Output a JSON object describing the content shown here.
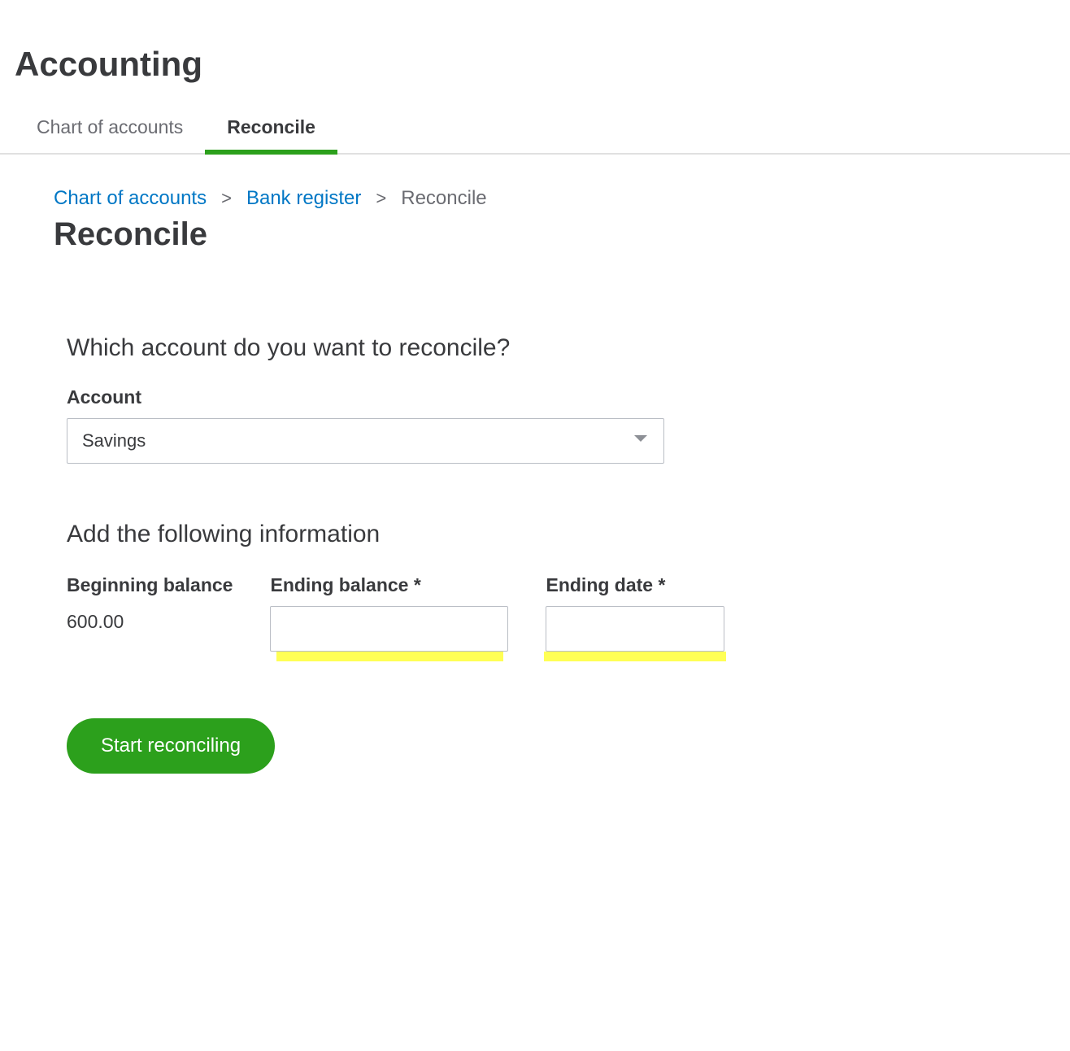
{
  "header": {
    "title": "Accounting"
  },
  "tabs": [
    {
      "label": "Chart of accounts",
      "active": false
    },
    {
      "label": "Reconcile",
      "active": true
    }
  ],
  "breadcrumb": {
    "items": [
      {
        "label": "Chart of accounts",
        "link": true
      },
      {
        "label": "Bank register",
        "link": true
      },
      {
        "label": "Reconcile",
        "link": false
      }
    ]
  },
  "page": {
    "subtitle": "Reconcile"
  },
  "form": {
    "prompt": "Which account do you want to reconcile?",
    "account": {
      "label": "Account",
      "value": "Savings"
    },
    "section_prompt": "Add the following information",
    "beginning_balance": {
      "label": "Beginning balance",
      "value": "600.00"
    },
    "ending_balance": {
      "label": "Ending balance *",
      "value": ""
    },
    "ending_date": {
      "label": "Ending date *",
      "value": ""
    },
    "submit_label": "Start reconciling"
  }
}
